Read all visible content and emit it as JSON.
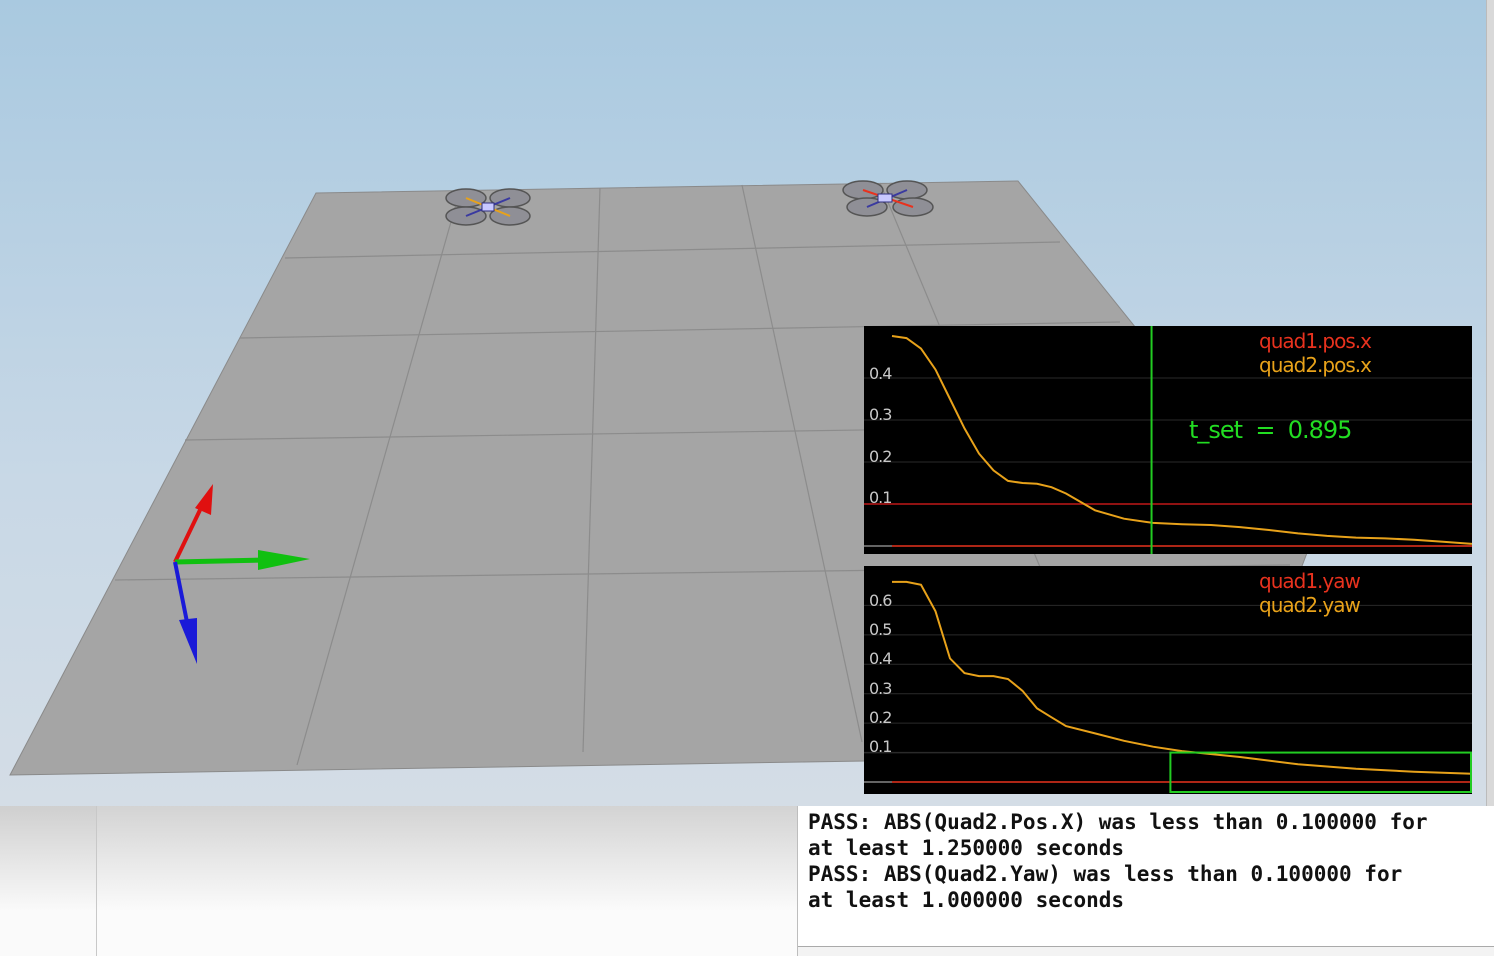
{
  "plots": [
    {
      "name": "position-plot",
      "legend": [
        {
          "label": "quad1.pos.x",
          "color": "#e8321e"
        },
        {
          "label": "quad2.pos.x",
          "color": "#e8a21a"
        }
      ],
      "annotation": {
        "label": "t_set",
        "value": "0.895",
        "separator": "="
      },
      "y_ticks": [
        "0.4",
        "0.3",
        "0.2",
        "0.1"
      ]
    },
    {
      "name": "yaw-plot",
      "legend": [
        {
          "label": "quad1.yaw",
          "color": "#e8321e"
        },
        {
          "label": "quad2.yaw",
          "color": "#e8a21a"
        }
      ],
      "y_ticks": [
        "0.6",
        "0.5",
        "0.4",
        "0.3",
        "0.2",
        "0.1"
      ]
    }
  ],
  "chart_data": [
    {
      "type": "line",
      "title": "",
      "ylim": [
        0,
        0.5
      ],
      "grid": true,
      "series": [
        {
          "name": "quad1.pos.x",
          "x": [
            0,
            1
          ],
          "y": [
            0,
            0
          ]
        },
        {
          "name": "quad2.pos.x",
          "x": [
            0.0,
            0.05,
            0.1,
            0.15,
            0.2,
            0.25,
            0.3,
            0.35,
            0.4,
            0.45,
            0.5,
            0.55,
            0.6,
            0.65,
            0.7,
            0.8,
            0.9,
            1.0,
            1.1,
            1.2,
            1.3,
            1.4,
            1.5,
            1.6,
            1.7,
            1.8,
            1.9,
            2.0
          ],
          "y": [
            0.5,
            0.495,
            0.47,
            0.42,
            0.35,
            0.28,
            0.22,
            0.18,
            0.155,
            0.15,
            0.148,
            0.14,
            0.125,
            0.105,
            0.085,
            0.065,
            0.055,
            0.052,
            0.05,
            0.045,
            0.038,
            0.03,
            0.024,
            0.02,
            0.018,
            0.015,
            0.01,
            0.005
          ]
        }
      ],
      "threshold": 0.1,
      "marker_x": 0.895
    },
    {
      "type": "line",
      "title": "",
      "ylim": [
        0,
        0.7
      ],
      "grid": true,
      "series": [
        {
          "name": "quad1.yaw",
          "x": [
            0,
            1
          ],
          "y": [
            0,
            0
          ]
        },
        {
          "name": "quad2.yaw",
          "x": [
            0.0,
            0.05,
            0.1,
            0.15,
            0.2,
            0.25,
            0.3,
            0.35,
            0.4,
            0.45,
            0.5,
            0.55,
            0.6,
            0.7,
            0.8,
            0.9,
            1.0,
            1.2,
            1.4,
            1.6,
            1.8,
            2.0
          ],
          "y": [
            0.68,
            0.68,
            0.67,
            0.58,
            0.42,
            0.37,
            0.36,
            0.36,
            0.35,
            0.31,
            0.25,
            0.22,
            0.19,
            0.165,
            0.14,
            0.12,
            0.105,
            0.085,
            0.06,
            0.045,
            0.035,
            0.028
          ]
        }
      ],
      "threshold": 0.1
    }
  ],
  "console": {
    "lines": [
      "PASS: ABS(Quad2.Pos.X) was less than 0.100000 for",
      "at least 1.250000 seconds",
      "PASS: ABS(Quad2.Yaw) was less than 0.100000 for",
      "at least 1.000000 seconds"
    ]
  }
}
